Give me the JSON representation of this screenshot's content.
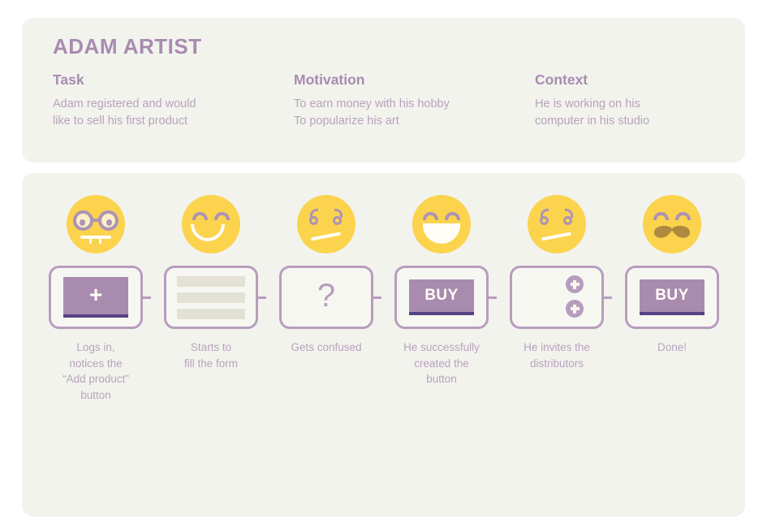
{
  "persona": {
    "title": "ADAM ARTIST",
    "columns": [
      {
        "heading": "Task",
        "body": "Adam registered and would\nlike to sell his first product"
      },
      {
        "heading": "Motivation",
        "body": "To earn money with his hobby\nTo popularize his art"
      },
      {
        "heading": "Context",
        "body": "He is working on his\ncomputer in his studio"
      }
    ]
  },
  "journey": {
    "steps": [
      {
        "face": "nerd-glasses-face",
        "card": "add-product-button-card",
        "card_label": "+",
        "caption": "Logs in,\nnotices the\n“Add product”\nbutton"
      },
      {
        "face": "smiling-face",
        "card": "form-fields-card",
        "card_label": "",
        "caption": "Starts to\nfill the form"
      },
      {
        "face": "confused-face",
        "card": "question-mark-card",
        "card_label": "?",
        "caption": "Gets confused"
      },
      {
        "face": "grinning-face",
        "card": "buy-button-card",
        "card_label": "BUY",
        "caption": "He successfully\ncreated the\nbutton"
      },
      {
        "face": "confused-face",
        "card": "invite-distributors-card",
        "card_label": "",
        "caption": "He invites the\ndistributors"
      },
      {
        "face": "mustache-face",
        "card": "final-buy-button-card",
        "card_label": "BUY",
        "caption": "Done!"
      }
    ]
  },
  "colors": {
    "page_background": "#ffffff",
    "panel_background": "#f2f3ed",
    "heading_purple": "#a98bb0",
    "body_purple": "#b8a2bd",
    "card_border": "#b79dbd",
    "button_fill": "#a98bb0",
    "button_underline": "#574184",
    "face_yellow": "#fbd34d",
    "face_feature_purple": "#ad93b5",
    "face_feature_white": "#fffdf5",
    "mustache_brown": "#ad8a3f",
    "form_line_gray": "#e3e0d6"
  }
}
